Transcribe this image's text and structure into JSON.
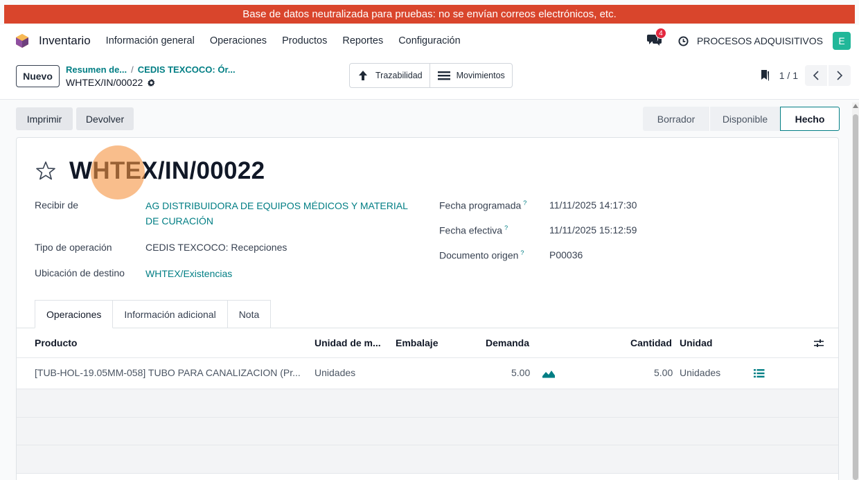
{
  "banner": {
    "text": "Base de datos neutralizada para pruebas: no se envían correos electrónicos, etc."
  },
  "navbar": {
    "app_name": "Inventario",
    "menu": [
      "Información general",
      "Operaciones",
      "Productos",
      "Reportes",
      "Configuración"
    ],
    "chat_badge": "4",
    "company": "PROCESOS ADQUISITIVOS",
    "avatar_letter": "E",
    "icons": {
      "logo": "inventory-cube-icon",
      "chat": "chat-bubbles-icon",
      "clock": "clock-icon"
    }
  },
  "control": {
    "new_label": "Nuevo",
    "breadcrumb": [
      "Resumen de...",
      "CEDIS TEXCOCO: Ór..."
    ],
    "breadcrumb_sep": "/",
    "record_name": "WHTEX/IN/00022",
    "smart_buttons": [
      "Trazabilidad",
      "Movimientos"
    ],
    "pager_value": "1 / 1"
  },
  "status": {
    "buttons": [
      "Imprimir",
      "Devolver"
    ],
    "stages": [
      "Borrador",
      "Disponible",
      "Hecho"
    ],
    "active_stage": "Hecho"
  },
  "form": {
    "title": "WHTEX/IN/00022",
    "left": [
      {
        "label": "Recibir de",
        "value_line1": "AG DISTRIBUIDORA DE EQUIPOS MÉDICOS Y MATERIAL",
        "value_line2": "DE CURACIÓN"
      },
      {
        "label": "Tipo de operación",
        "value": "CEDIS TEXCOCO: Recepciones"
      },
      {
        "label": "Ubicación de destino",
        "value": "WHTEX/Existencias"
      }
    ],
    "right": [
      {
        "label": "Fecha programada",
        "hint": "?",
        "value": "11/11/2025 14:17:30"
      },
      {
        "label": "Fecha efectiva",
        "hint": "?",
        "value": "11/11/2025 15:12:59"
      },
      {
        "label": "Documento origen",
        "hint": "?",
        "value": "P00036"
      }
    ]
  },
  "tabs": [
    "Operaciones",
    "Información adicional",
    "Nota"
  ],
  "table": {
    "headers": [
      "Producto",
      "Unidad de m...",
      "Embalaje",
      "Demanda",
      "Cantidad",
      "Unidad"
    ],
    "rows": [
      {
        "product": "[TUB-HOL-19.05MM-058] TUBO PARA CANALIZACION (Pr...",
        "uom": "Unidades",
        "packaging": "",
        "demand": "5.00",
        "quantity": "5.00",
        "unit": "Unidades"
      }
    ]
  },
  "colors": {
    "accent": "#017e84",
    "banner": "#d9452c",
    "avatar": "#21b799",
    "badge": "#e3283f"
  }
}
